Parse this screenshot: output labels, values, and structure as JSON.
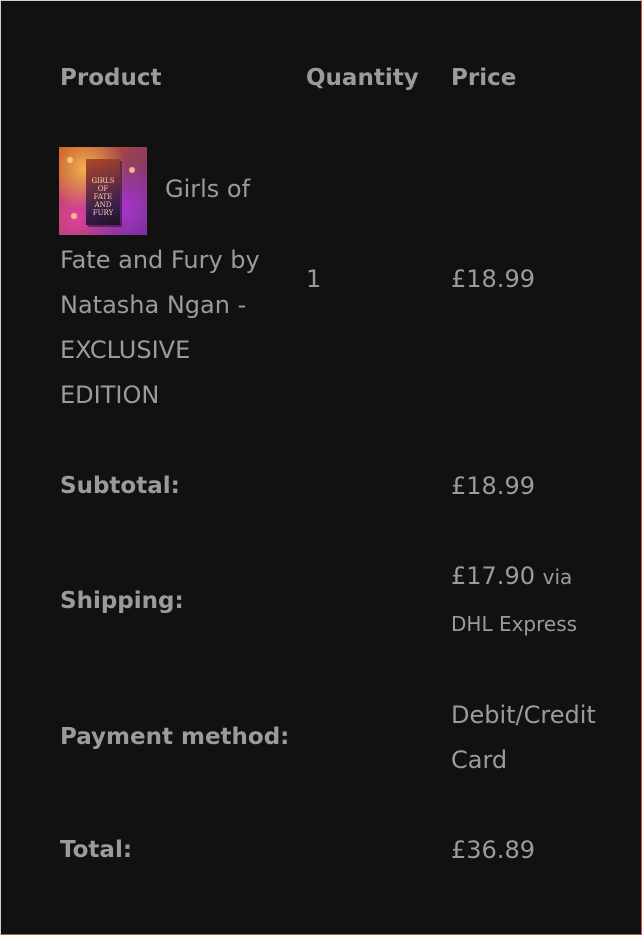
{
  "table": {
    "headers": {
      "product": "Product",
      "quantity": "Quantity",
      "price": "Price"
    },
    "item": {
      "name_first_line": "Girls of",
      "name_lines": [
        "Fate and Fury by",
        "Natasha Ngan -",
        "EXCLUSIVE",
        "EDITION"
      ],
      "thumbnail_text": "GIRLS OF FATE AND FURY",
      "quantity": "1",
      "price": "£18.99"
    }
  },
  "totals": {
    "subtotal_label": "Subtotal:",
    "subtotal_value": "£18.99",
    "shipping_label": "Shipping:",
    "shipping_amount": "£17.90",
    "shipping_via": "via",
    "shipping_carrier": "DHL Express",
    "payment_label": "Payment method:",
    "payment_line1": "Debit/Credit",
    "payment_line2": "Card",
    "total_label": "Total:",
    "total_value": "£36.89"
  },
  "colors": {
    "background": "#111111",
    "text": "#9b9b9b"
  }
}
